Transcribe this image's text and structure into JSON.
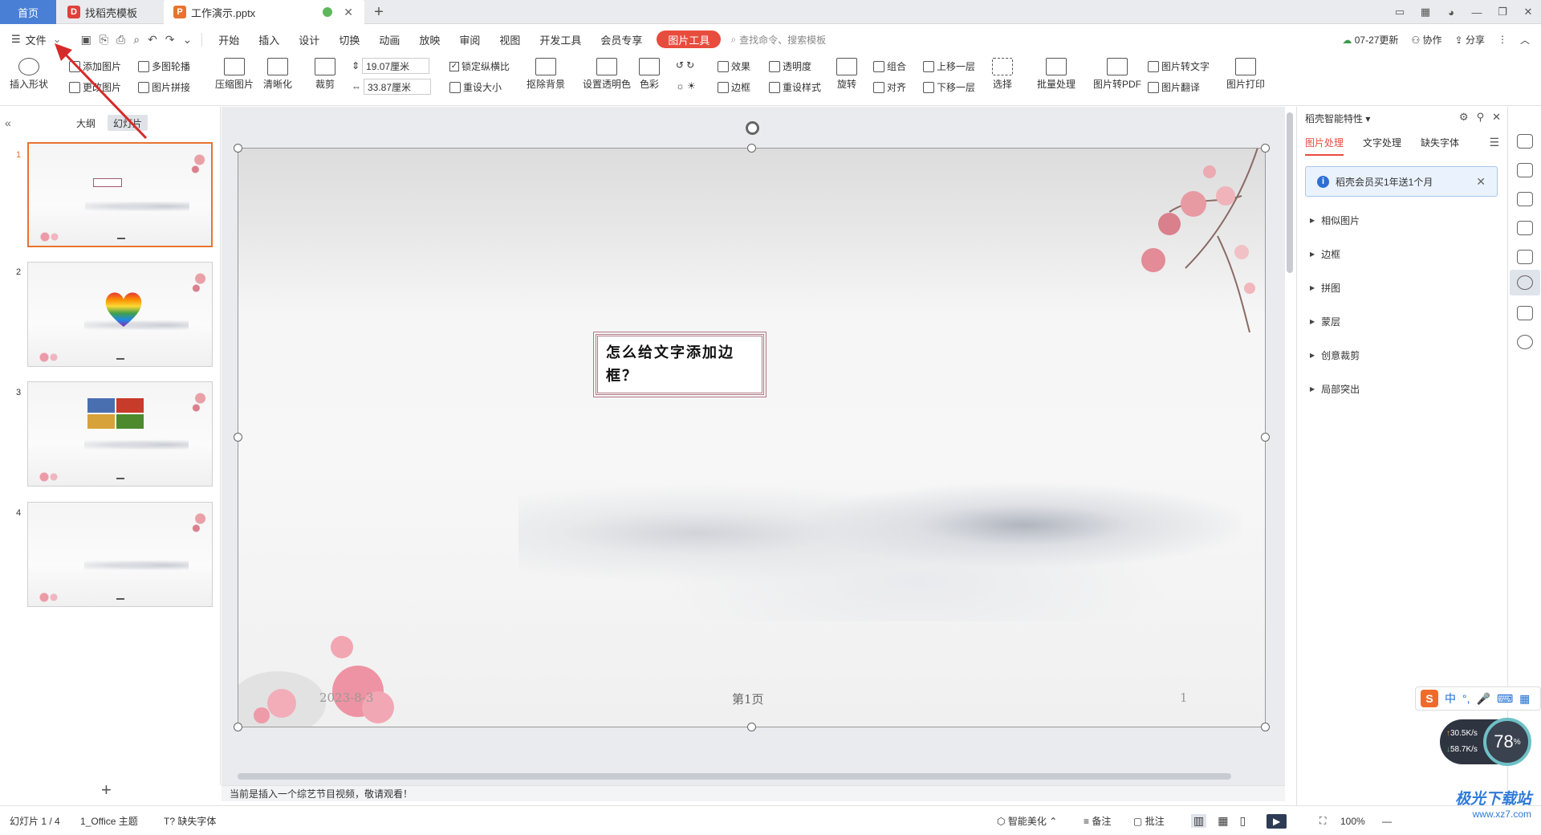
{
  "titlebar": {
    "home_tab": "首页",
    "tabs": [
      {
        "label": "找稻壳模板"
      },
      {
        "label": "工作演示.pptx"
      }
    ],
    "new_tab": "+"
  },
  "menubar": {
    "file": "文件",
    "items": [
      "开始",
      "插入",
      "设计",
      "切换",
      "动画",
      "放映",
      "审阅",
      "视图",
      "开发工具",
      "会员专享"
    ],
    "picture_tools": "图片工具",
    "search": "查找命令、搜索模板",
    "update": "07-27更新",
    "collab": "协作",
    "share": "分享"
  },
  "ribbon": {
    "insert_shape": "插入形状",
    "add_picture": "添加图片",
    "change_picture": "更改图片",
    "multi_carousel": "多图轮播",
    "picture_collage": "图片拼接",
    "compress": "压缩图片",
    "sharpen": "清晰化",
    "crop": "裁剪",
    "height": "19.07厘米",
    "width": "33.87厘米",
    "lock_ratio": "锁定纵横比",
    "reset_size": "重设大小",
    "remove_bg": "抠除背景",
    "set_transparent": "设置透明色",
    "color": "色彩",
    "effect": "效果",
    "transparency": "透明度",
    "border": "边框",
    "reset_style": "重设样式",
    "rotate": "旋转",
    "group": "组合",
    "align": "对齐",
    "bring_forward": "上移一层",
    "send_backward": "下移一层",
    "select": "选择",
    "batch": "批量处理",
    "to_pdf": "图片转PDF",
    "to_text": "图片转文字",
    "translate": "图片翻译",
    "print": "图片打印"
  },
  "left_panel": {
    "outline_tab": "大纲",
    "slides_tab": "幻灯片",
    "slides": [
      {
        "num": "1"
      },
      {
        "num": "2"
      },
      {
        "num": "3"
      },
      {
        "num": "4"
      }
    ],
    "add": "+"
  },
  "slide": {
    "title": "怎么给文字添加边框？",
    "date": "2023-8-3",
    "page": "第1页",
    "number": "1"
  },
  "status_message": "当前是插入一个综艺节目视频，敬请观看！",
  "right_panel": {
    "title": "稻壳智能特性",
    "tabs": [
      "图片处理",
      "文字处理",
      "缺失字体"
    ],
    "banner": "稻壳会员买1年送1个月",
    "items": [
      "相似图片",
      "边框",
      "拼图",
      "蒙层",
      "创意裁剪",
      "局部突出"
    ]
  },
  "statusbar": {
    "slide_count": "幻灯片 1 / 4",
    "theme": "1_Office 主题",
    "missing_font": "缺失字体",
    "beautify": "智能美化",
    "notes": "备注",
    "comments": "批注",
    "zoom": "100%"
  },
  "overlay": {
    "ime": "中",
    "net_up": "30.5K/s",
    "net_down": "58.7K/s",
    "cpu": "78",
    "watermark_title": "极光下载站",
    "watermark_url": "www.xz7.com"
  },
  "colors": {
    "accent": "#e84c3d",
    "home_tab": "#4a7fd6",
    "active_thumb": "#e8742f"
  }
}
